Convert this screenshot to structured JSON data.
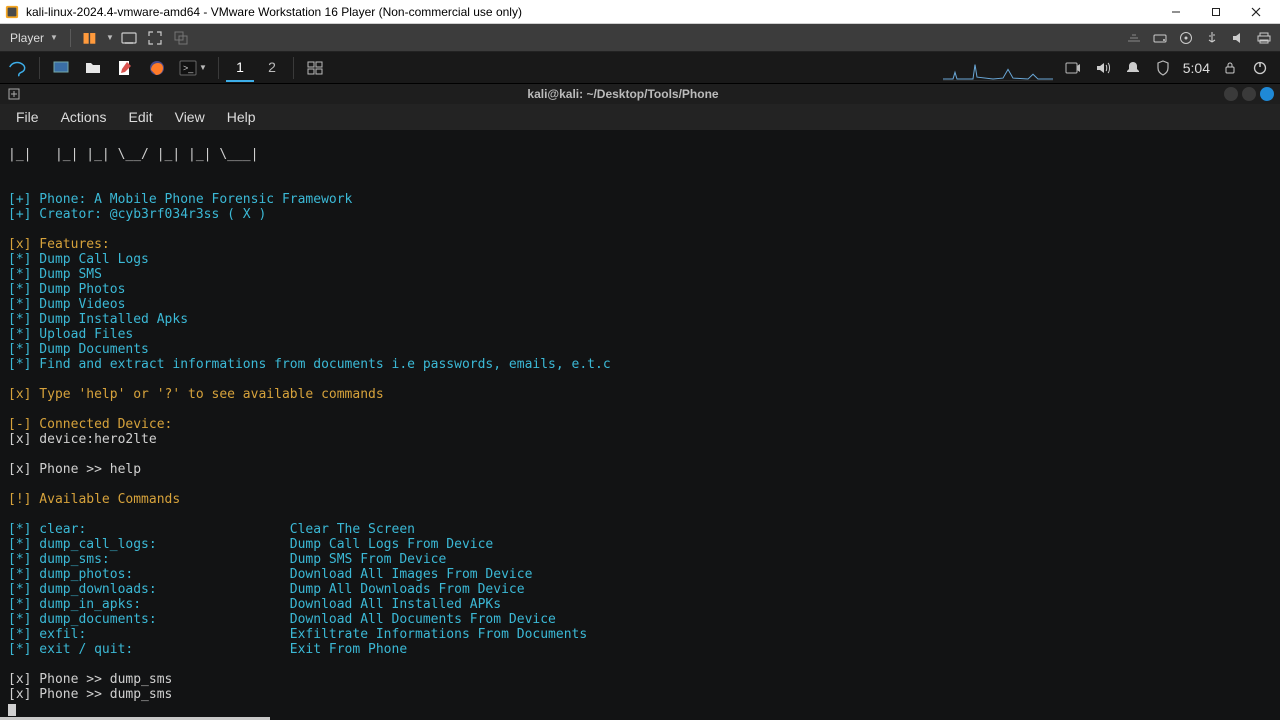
{
  "window": {
    "title": "kali-linux-2024.4-vmware-amd64 - VMware Workstation 16 Player (Non-commercial use only)"
  },
  "vmware": {
    "player_label": "Player"
  },
  "kali": {
    "workspaces": [
      "1",
      "2"
    ],
    "active_workspace": 0,
    "clock": "5:04"
  },
  "terminal": {
    "title": "kali@kali: ~/Desktop/Tools/Phone",
    "menus": [
      "File",
      "Actions",
      "Edit",
      "View",
      "Help"
    ]
  },
  "term": {
    "ascii_tail": "|_|   |_| |_| \\__/ |_| |_| \\___|",
    "tag_banner1_brk": "[+]",
    "tag_banner1_txt": " Phone: A Mobile Phone Forensic Framework",
    "tag_banner2_brk": "[+]",
    "tag_banner2_txt": " Creator: @cyb3rf034r3ss ( X )",
    "feat_hdr_brk": "[x]",
    "feat_hdr_txt": " Features:",
    "f1_brk": "[*]",
    "f1_txt": " Dump Call Logs",
    "f2_brk": "[*]",
    "f2_txt": " Dump SMS",
    "f3_brk": "[*]",
    "f3_txt": " Dump Photos",
    "f4_brk": "[*]",
    "f4_txt": " Dump Videos",
    "f5_brk": "[*]",
    "f5_txt": " Dump Installed Apks",
    "f6_brk": "[*]",
    "f6_txt": " Upload Files",
    "f7_brk": "[*]",
    "f7_txt": " Dump Documents",
    "f8_brk": "[*]",
    "f8_txt": " Find and extract informations from documents i.e passwords, emails, e.t.c",
    "helpline_brk": "[x]",
    "helpline_txt": " Type 'help' or '?' to see available commands",
    "conn_hdr_brk": "[-]",
    "conn_hdr_txt": " Connected Device:",
    "dev_brk": "[x]",
    "dev_txt": " device:hero2lte",
    "prompt1_brk": "[x]",
    "prompt1_txt": " Phone >> help",
    "avail_hdr_brk": "[!]",
    "avail_hdr_txt": " Available Commands",
    "c1_brk": "[*]",
    "c1_name": " clear:",
    "c1_desc": "Clear The Screen",
    "c2_brk": "[*]",
    "c2_name": " dump_call_logs:",
    "c2_desc": "Dump Call Logs From Device",
    "c3_brk": "[*]",
    "c3_name": " dump_sms:",
    "c3_desc": "Dump SMS From Device",
    "c4_brk": "[*]",
    "c4_name": " dump_photos:",
    "c4_desc": "Download All Images From Device",
    "c5_brk": "[*]",
    "c5_name": " dump_downloads:",
    "c5_desc": "Dump All Downloads From Device",
    "c6_brk": "[*]",
    "c6_name": " dump_in_apks:",
    "c6_desc": "Download All Installed APKs",
    "c7_brk": "[*]",
    "c7_name": " dump_documents:",
    "c7_desc": "Download All Documents From Device",
    "c8_brk": "[*]",
    "c8_name": " exfil:",
    "c8_desc": "Exfiltrate Informations From Documents",
    "c9_brk": "[*]",
    "c9_name": " exit / quit:",
    "c9_desc": "Exit From Phone",
    "prompt2_brk": "[x]",
    "prompt2_txt": " Phone >> dump_sms",
    "prompt3_brk": "[x]",
    "prompt3_txt": " Phone >> dump_sms"
  }
}
